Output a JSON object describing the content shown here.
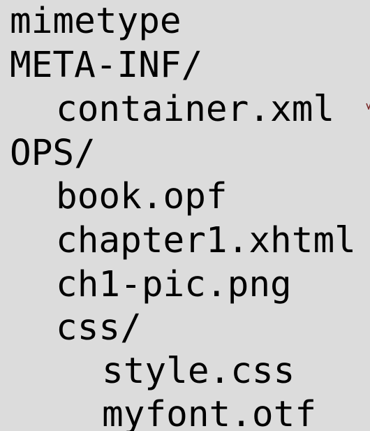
{
  "tree": {
    "items": [
      {
        "label": "mimetype",
        "depth": 0
      },
      {
        "label": "META-INF/",
        "depth": 0
      },
      {
        "label": "container.xml",
        "depth": 1
      },
      {
        "label": "OPS/",
        "depth": 0
      },
      {
        "label": "book.opf",
        "depth": 1
      },
      {
        "label": "chapter1.xhtml",
        "depth": 1
      },
      {
        "label": "ch1-pic.png",
        "depth": 1
      },
      {
        "label": "css/",
        "depth": 1
      },
      {
        "label": "style.css",
        "depth": 2
      },
      {
        "label": "myfont.otf",
        "depth": 2
      }
    ]
  },
  "colors": {
    "background": "#dcdcdc",
    "text": "#000000",
    "edge_mark": "#7a2a2a"
  }
}
